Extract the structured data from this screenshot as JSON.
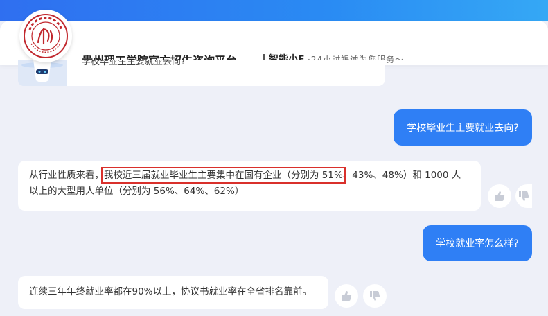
{
  "header": {
    "title": "贵州理工学院官方招生咨询平台",
    "assistant_name": "智能小E",
    "tagline": "·24小时竭诚为您服务～",
    "logo_alt": "Guizhou Institute of Technology"
  },
  "chat": {
    "prev_bot_text": "学校毕业生主要就业去向?",
    "messages": [
      {
        "role": "user",
        "text": "学校毕业生主要就业去向?"
      },
      {
        "role": "bot",
        "prefix": "从行业性质来看，",
        "highlight": "我校近三届就业毕业生主要集中在国有企业（分别为 51%",
        "rest_line1": "、43%、48%）和 1000 人",
        "line2": "以上的大型用人单位（分别为 56%、64%、62%）"
      },
      {
        "role": "user",
        "text": "学校就业率怎么样?"
      },
      {
        "role": "bot",
        "text": "连续三年年终就业率都在90%以上，协议书就业率在全省排名靠前。"
      }
    ]
  },
  "colors": {
    "accent": "#2f7ff5",
    "background": "#eef0f8",
    "highlight_border": "#d9302b"
  }
}
